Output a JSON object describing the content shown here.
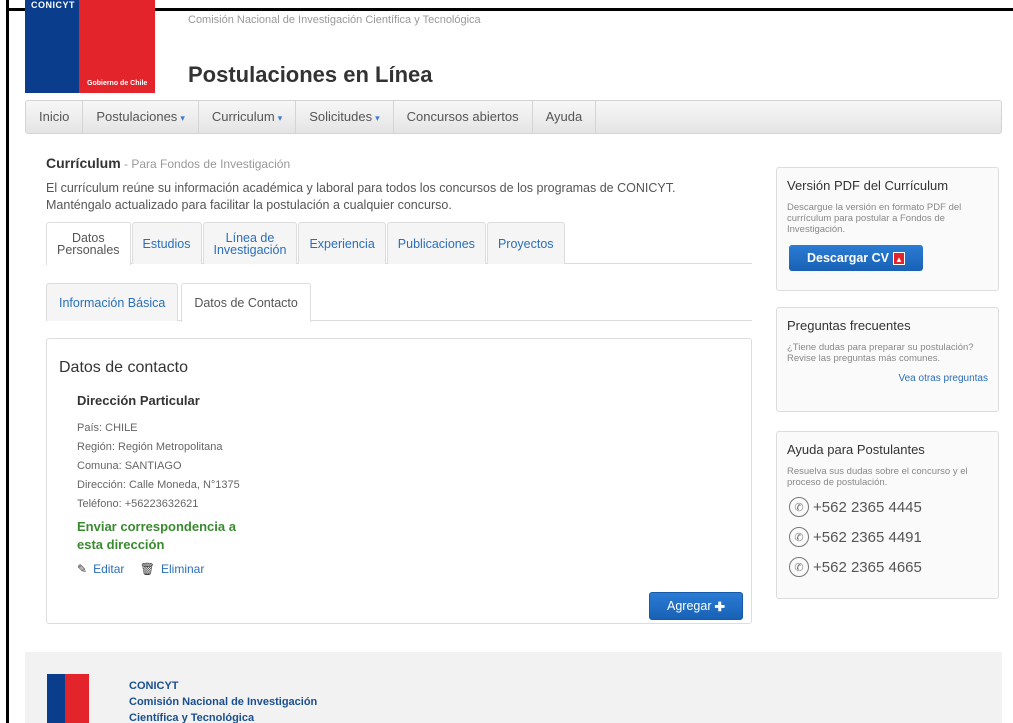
{
  "header": {
    "org_name": "Comisión Nacional de Investigación Científica y Tecnológica",
    "site_title": "Postulaciones en Línea",
    "logo_text": "Gobierno de Chile",
    "logo_top_text": "CONICYT"
  },
  "nav": {
    "items": [
      {
        "label": "Inicio",
        "dropdown": false
      },
      {
        "label": "Postulaciones",
        "dropdown": true
      },
      {
        "label": "Curriculum",
        "dropdown": true
      },
      {
        "label": "Solicitudes",
        "dropdown": true
      },
      {
        "label": "Concursos abiertos",
        "dropdown": false
      },
      {
        "label": "Ayuda",
        "dropdown": false
      }
    ],
    "caret": "▾"
  },
  "page": {
    "title": "Currículum",
    "subtitle": " - Para Fondos de Investigación",
    "intro": "El currículum reúne su información académica y laboral para todos los concursos de los programas de CONICYT. Manténgalo actualizado para facilitar la postulación a cualquier concurso."
  },
  "tabs_main": [
    {
      "line1": "Datos",
      "line2": "Personales",
      "active": true
    },
    {
      "line1": "Estudios",
      "line2": "",
      "active": false
    },
    {
      "line1": "Línea de",
      "line2": "Investigación",
      "active": false
    },
    {
      "line1": "Experiencia",
      "line2": "",
      "active": false
    },
    {
      "line1": "Publicaciones",
      "line2": "",
      "active": false
    },
    {
      "line1": "Proyectos",
      "line2": "",
      "active": false
    }
  ],
  "tabs_sub": [
    {
      "label": "Información Básica",
      "active": false
    },
    {
      "label": "Datos de Contacto",
      "active": true
    }
  ],
  "contact": {
    "panel_title": "Datos de contacto",
    "address_title": "Dirección Particular",
    "lines": [
      "País: CHILE",
      "Región: Región Metropolitana",
      "Comuna: SANTIAGO",
      "Dirección: Calle Moneda, N°1375",
      "Teléfono: +56223632621"
    ],
    "correspondence_line1": "Enviar correspondencia a",
    "correspondence_line2": "esta dirección",
    "edit_label": "Editar",
    "delete_label": "Eliminar",
    "add_label": "Agregar"
  },
  "sidebar": {
    "pdf": {
      "title": "Versión PDF del Currículum",
      "text": "Descargue la versión en formato PDF del currículum para postular a Fondos de Investigación.",
      "button": "Descargar CV"
    },
    "faq": {
      "title": "Preguntas frecuentes",
      "text": "¿Tiene dudas para preparar su postulación? Revise las preguntas más comunes.",
      "link": "Vea otras preguntas"
    },
    "help": {
      "title": "Ayuda para Postulantes",
      "text": "Resuelva sus dudas sobre el concurso y el proceso de postulación.",
      "phones": [
        "+562 2365 4445",
        "+562 2365 4491",
        "+562 2365 4665"
      ]
    }
  },
  "footer": {
    "line1": "CONICYT",
    "line2": "Comisión Nacional de Investigación",
    "line3": "Científica y Tecnológica"
  }
}
